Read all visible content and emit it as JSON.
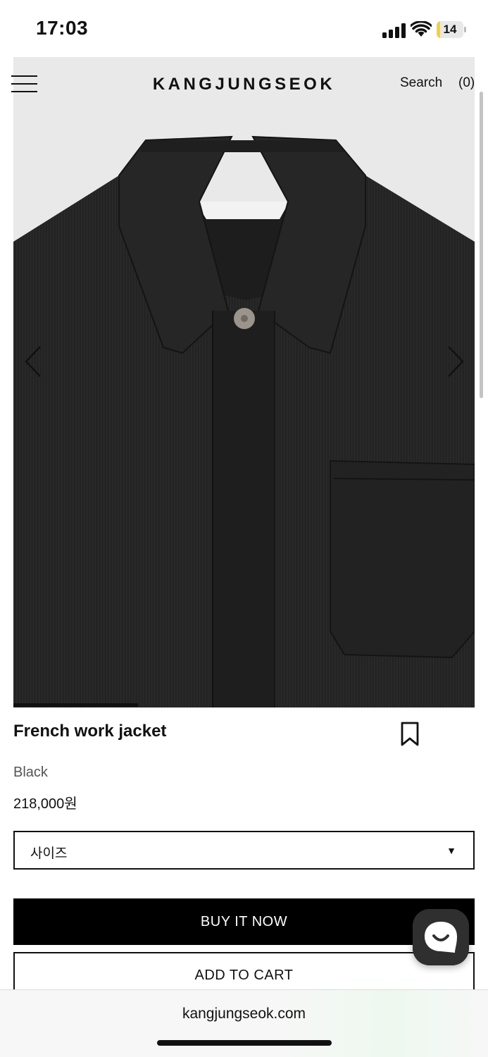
{
  "status_bar": {
    "time": "17:03",
    "battery": "14",
    "battery_level": 0.14
  },
  "header": {
    "brand": "KANGJUNGSEOK",
    "search_label": "Search",
    "cart_count": "(0)"
  },
  "gallery": {
    "image": "black-corduroy-jacket-photo",
    "progress": 0.27
  },
  "product": {
    "name": "French work jacket",
    "color": "Black",
    "price": "218,000원",
    "size_select": {
      "label": "사이즈",
      "caret": "▼"
    }
  },
  "actions": {
    "buy_now": "BUY IT NOW",
    "add_to_cart": "ADD TO CART"
  },
  "browser": {
    "url": "kangjungseok.com"
  }
}
